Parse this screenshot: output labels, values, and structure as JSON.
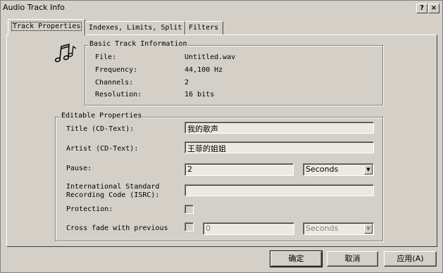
{
  "window": {
    "title": "Audio Track Info",
    "help_label": "?",
    "close_label": "×"
  },
  "tabs": [
    {
      "label": "Track Properties"
    },
    {
      "label": "Indexes, Limits, Split"
    },
    {
      "label": "Filters"
    }
  ],
  "basic_info": {
    "legend": "Basic Track Information",
    "icon": "music-notes-icon",
    "rows": [
      {
        "label": "File:",
        "value": "Untitled.wav"
      },
      {
        "label": "Frequency:",
        "value": "44,100 Hz"
      },
      {
        "label": "Channels:",
        "value": "2"
      },
      {
        "label": "Resolution:",
        "value": "16 bits"
      }
    ]
  },
  "editable": {
    "legend": "Editable Properties",
    "title_label": "Title (CD-Text):",
    "title_value": "我的歌声",
    "artist_label": "Artist (CD-Text):",
    "artist_value": "王菲的姐姐",
    "pause_label": "Pause:",
    "pause_value": "2",
    "pause_unit": "Seconds",
    "isrc_label_line1": "International Standard",
    "isrc_label_line2": "Recording Code (ISRC):",
    "isrc_value": "",
    "protection_label": "Protection:",
    "protection_checked": false,
    "crossfade_label": "Cross fade with previous",
    "crossfade_checked": false,
    "crossfade_value": "0",
    "crossfade_unit": "Seconds"
  },
  "buttons": {
    "ok": "确定",
    "cancel": "取消",
    "apply": "应用(A)"
  }
}
